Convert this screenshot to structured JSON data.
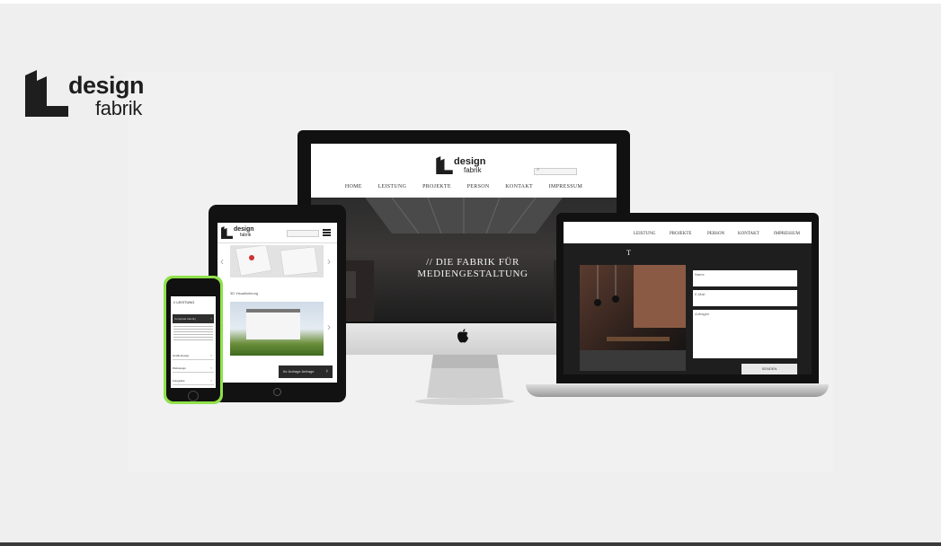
{
  "logo": {
    "word1": "design",
    "word2": "fabrik"
  },
  "desktop_site": {
    "nav": [
      "HOME",
      "LEISTUNG",
      "PROJEKTE",
      "PERSON",
      "KONTAKT",
      "IMPRESSUM"
    ],
    "tagline_line1": "// DIE FABRIK FÜR",
    "tagline_line2": "MEDIENGESTALTUNG"
  },
  "laptop_site": {
    "nav": [
      "LEISTUNG",
      "PROJEKTE",
      "PERSON",
      "KONTAKT",
      "IMPRESSUM"
    ],
    "heading_fragment": "T",
    "form": {
      "name_placeholder": "Name",
      "email_placeholder": "E-Mail",
      "message_placeholder": "Anfragen",
      "submit_label": "SENDEN"
    }
  },
  "tablet_site": {
    "caption": "3D Visualisierung",
    "cta_label": "Ihr Anfrage Anfrage"
  },
  "phone_site": {
    "section_title": "// LEISTUNG",
    "active_item": "Corporate Identity",
    "items": [
      "Grafik-Design",
      "Webdesign",
      "Fotografie"
    ]
  },
  "icons": {
    "search": "search-icon",
    "menu": "menu-icon",
    "apple": "apple-logo-icon",
    "arrow_left": "chevron-left-icon",
    "arrow_right": "chevron-right-icon",
    "chevron": "chevron-down-icon"
  },
  "colors": {
    "phone_frame": "#8fe04a",
    "device_body": "#111111",
    "background": "#efefef"
  }
}
